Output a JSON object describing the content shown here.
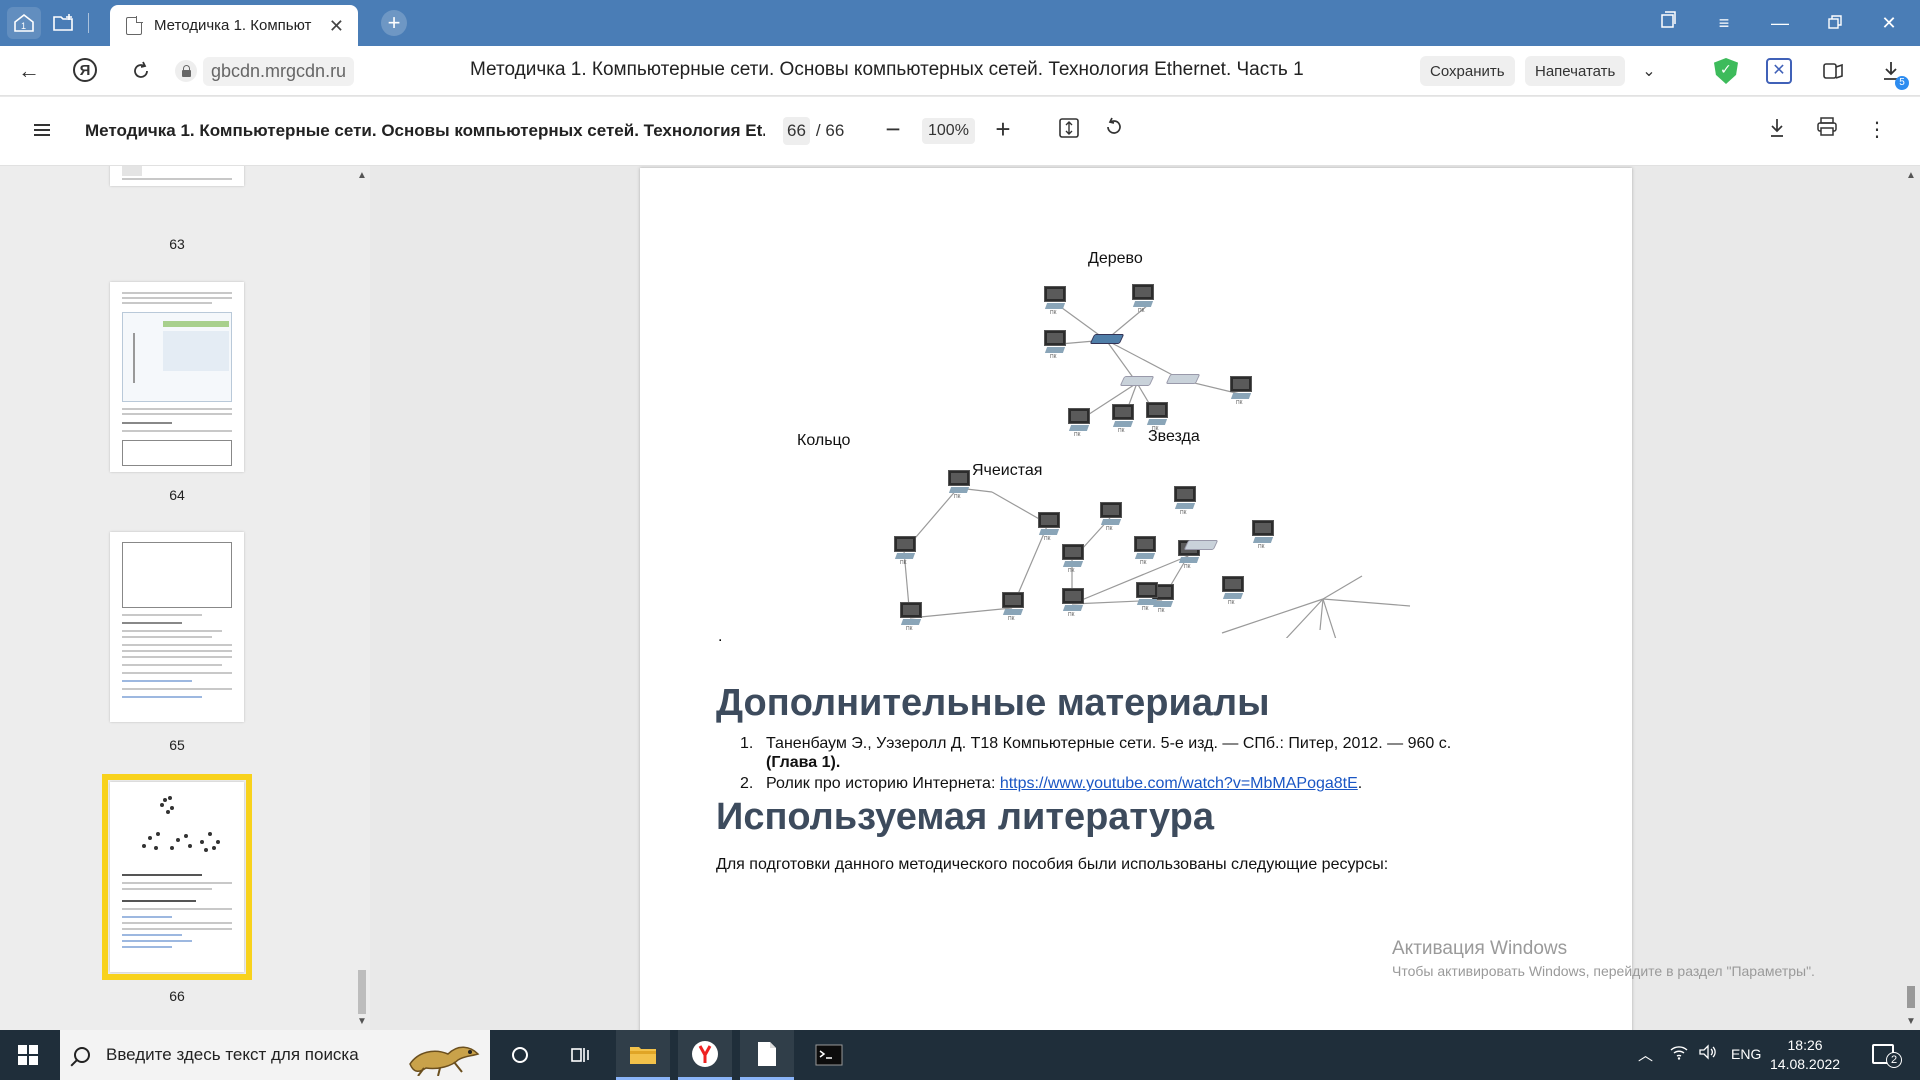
{
  "browser": {
    "tab_title": "Методичка 1. Компьют",
    "host": "gbcdn.mrgcdn.ru",
    "document_title": "Методичка 1. Компьютерные сети. Основы компьютерных сетей. Технология Ethernet. Часть 1",
    "save_label": "Сохранить",
    "print_label": "Напечатать",
    "downloads_count": "5",
    "home_badge": "1"
  },
  "pdf": {
    "title": "Методичка 1. Компьютерные сети. Основы компьютерных сетей. Технология Et...",
    "current_page": "66",
    "total_pages": "/ 66",
    "zoom": "100%"
  },
  "thumbnails": [
    {
      "label": "63"
    },
    {
      "label": "64"
    },
    {
      "label": "65"
    },
    {
      "label": "66"
    }
  ],
  "diagram_labels": {
    "tree": "Дерево",
    "ring": "Кольцо",
    "mesh": "Ячеистая",
    "star": "Звезда",
    "pc_caption": "ПК"
  },
  "content": {
    "stray_dot": ".",
    "heading_additional": "Дополнительные материалы",
    "references": [
      {
        "num": "1.",
        "text": "Таненбаум Э., Уэзеролл Д. Т18  Компьютерные сети. 5-е изд. — СПб.: Питер, 2012. — 960 с.",
        "bold": "(Глава 1)."
      },
      {
        "num": "2.",
        "text": "Ролик про историю Интернета: ",
        "link": "https://www.youtube.com/watch?v=MbMAPoga8tE",
        "after": "."
      }
    ],
    "heading_literature": "Используемая литература",
    "intro": "Для подготовки данного методического пособия были использованы следующие ресурсы:"
  },
  "activation": {
    "title": "Активация Windows",
    "subtitle": "Чтобы активировать Windows, перейдите в раздел \"Параметры\"."
  },
  "taskbar": {
    "search_placeholder": "Введите здесь текст для поиска",
    "language": "ENG",
    "time": "18:26",
    "date": "14.08.2022",
    "notifications": "2"
  },
  "colors": {
    "tabbar": "#4a7db6",
    "heading": "#3d4b5d",
    "link": "#1a56c4",
    "thumb_highlight": "#f8d21c",
    "taskbar": "#1f2e3a"
  }
}
